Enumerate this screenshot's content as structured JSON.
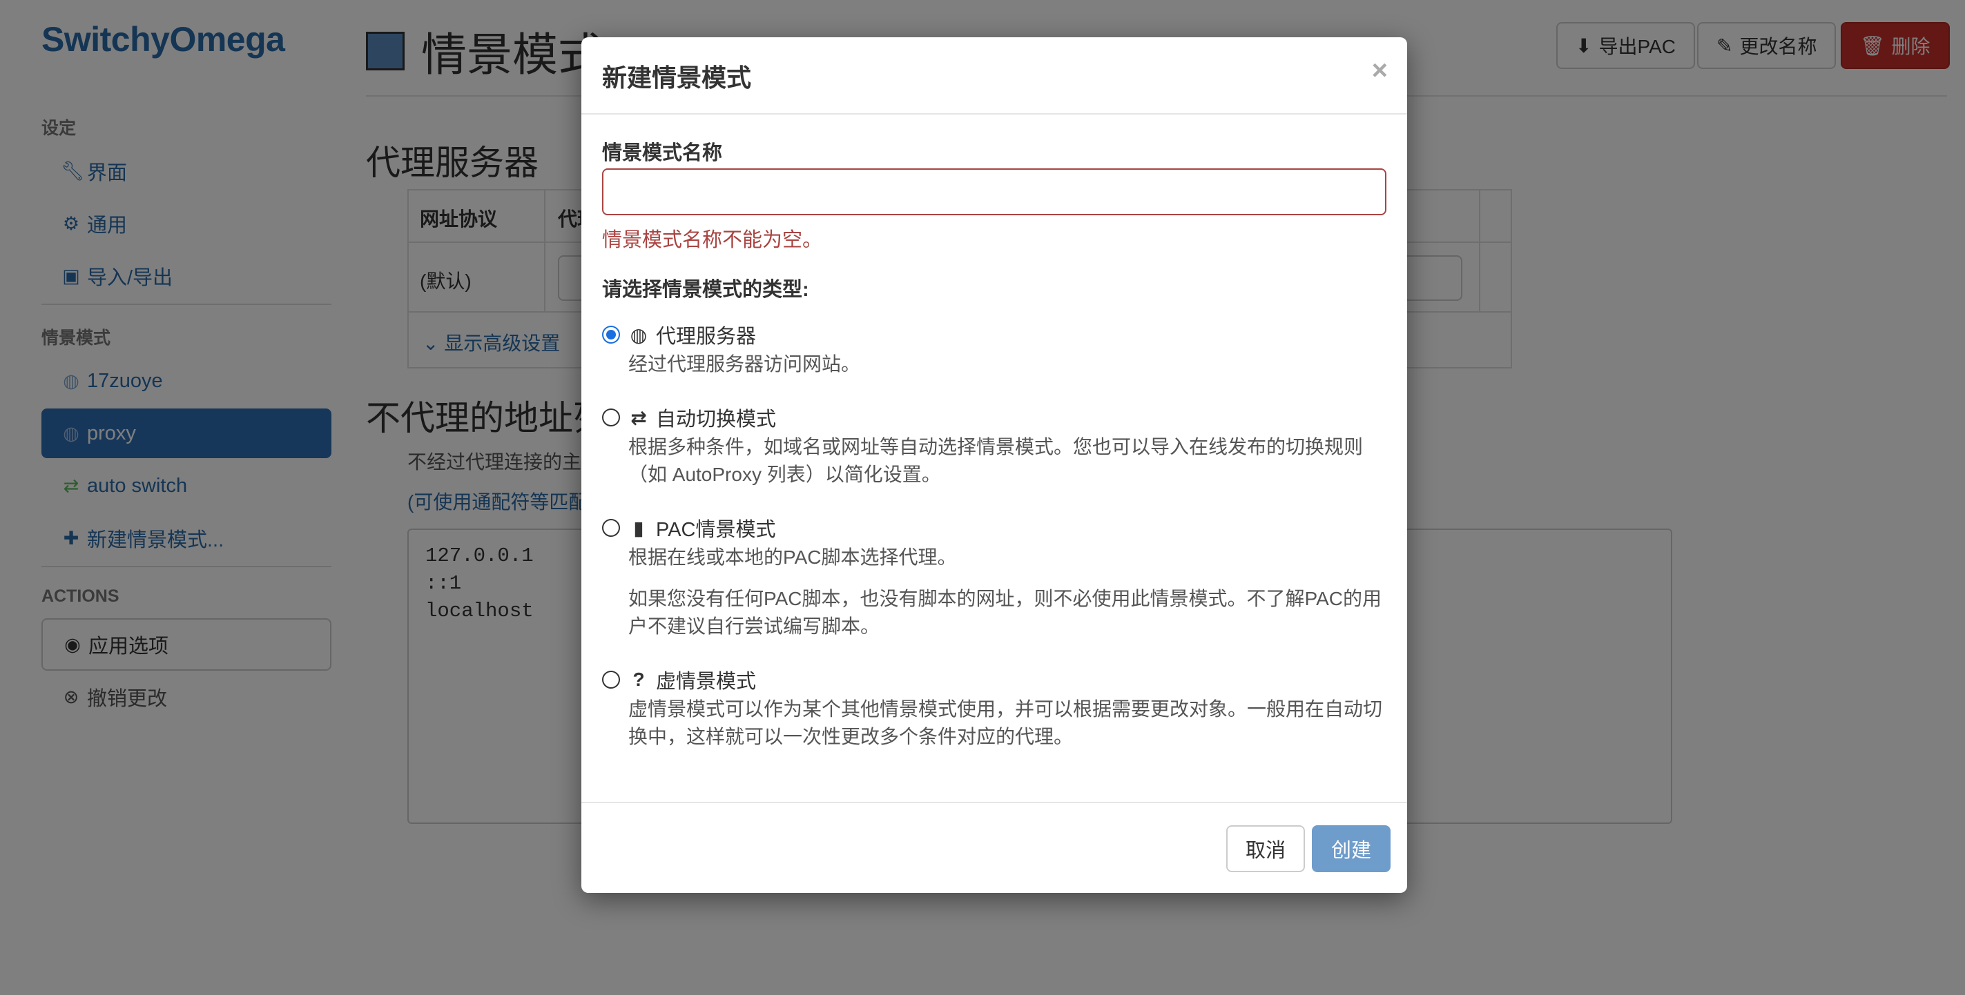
{
  "app": {
    "brand": "SwitchyOmega"
  },
  "sidebar": {
    "settings_header": "设定",
    "settings_items": [
      {
        "label": "界面",
        "icon": "wrench-icon"
      },
      {
        "label": "通用",
        "icon": "gear-icon"
      },
      {
        "label": "导入/导出",
        "icon": "floppy-icon"
      }
    ],
    "profiles_header": "情景模式",
    "profiles": [
      {
        "label": "17zuoye",
        "icon": "globe-icon"
      },
      {
        "label": "proxy",
        "icon": "globe-icon",
        "active": true
      },
      {
        "label": "auto switch",
        "icon": "retweet-icon"
      },
      {
        "label": "新建情景模式...",
        "icon": "plus-icon"
      }
    ],
    "actions_header": "ACTIONS",
    "actions": [
      {
        "label": "应用选项",
        "icon": "check-circle-icon"
      },
      {
        "label": "撤销更改",
        "icon": "x-circle-icon"
      }
    ]
  },
  "page": {
    "title": "情景模式:",
    "buttons": {
      "export_pac": "导出PAC",
      "rename": "更改名称",
      "delete": "删除"
    },
    "proxy_section_title": "代理服务器",
    "table": {
      "col_protocol": "网址协议",
      "col_proxy": "代理",
      "row_default": "(默认)",
      "advanced_link": "显示高级设置"
    },
    "bypass_section_title": "不代理的地址列",
    "bypass_desc": "不经过代理连接的主",
    "bypass_hint": "(可使用通配符等匹配",
    "bypass_list": "127.0.0.1\n::1\nlocalhost"
  },
  "modal": {
    "title": "新建情景模式",
    "close": "×",
    "name_label": "情景模式名称",
    "name_value": "",
    "name_error": "情景模式名称不能为空。",
    "type_label": "请选择情景模式的类型:",
    "options": [
      {
        "label": "代理服务器",
        "icon": "globe-icon",
        "checked": true,
        "desc": "经过代理服务器访问网站。"
      },
      {
        "label": "自动切换模式",
        "icon": "retweet-icon",
        "checked": false,
        "desc": "根据多种条件，如域名或网址等自动选择情景模式。您也可以导入在线发布的切换规则（如 AutoProxy 列表）以简化设置。"
      },
      {
        "label": "PAC情景模式",
        "icon": "file-icon",
        "checked": false,
        "desc": "根据在线或本地的PAC脚本选择代理。",
        "desc2": "如果您没有任何PAC脚本，也没有脚本的网址，则不必使用此情景模式。不了解PAC的用户不建议自行尝试编写脚本。"
      },
      {
        "label": "虚情景模式",
        "icon": "question-circle-icon",
        "checked": false,
        "desc": "虚情景模式可以作为某个其他情景模式使用，并可以根据需要更改对象。一般用在自动切换中，这样就可以一次性更改多个条件对应的代理。"
      }
    ],
    "cancel": "取消",
    "create": "创建"
  },
  "colors": {
    "accent": "#2a6aa8",
    "active_bg": "#2f6eb5",
    "danger": "#c9302c",
    "error": "#a94442",
    "create_btn": "#6e9ccb"
  }
}
